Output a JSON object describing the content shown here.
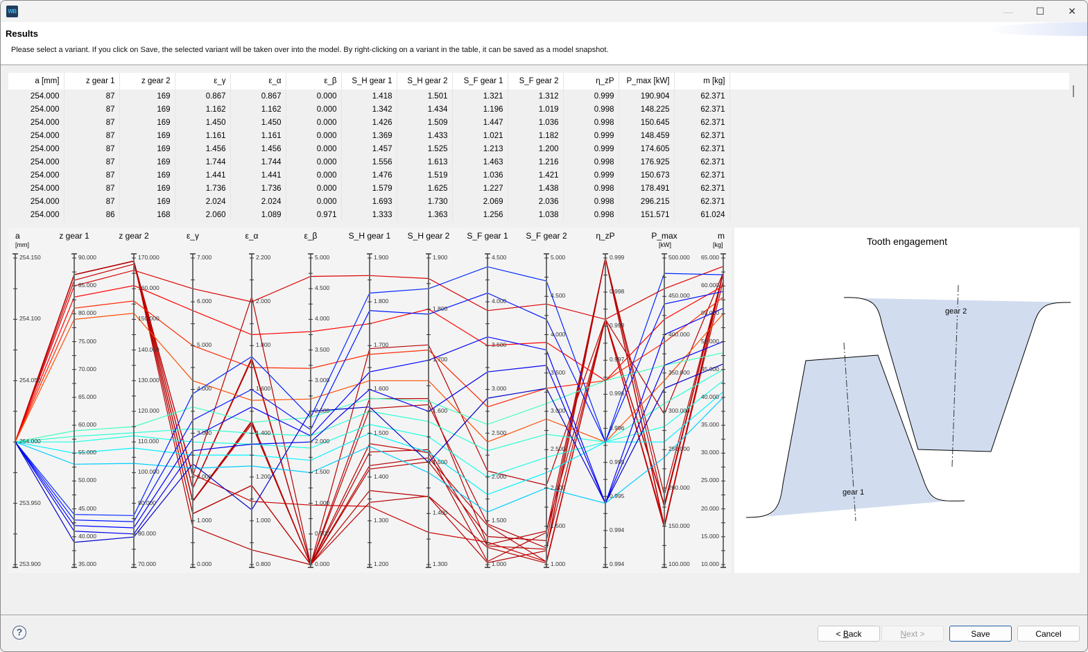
{
  "window": {
    "app_icon_text": "WB",
    "minimize_icon": "—",
    "maximize_icon": "☐",
    "close_icon": "✕"
  },
  "banner": {
    "title": "Results",
    "description": "Please select a variant. If you click on Save, the selected variant will be taken over into the model. By right-clicking on a variant in the table, it can be saved as a model snapshot."
  },
  "table": {
    "columns": [
      "a [mm]",
      "z gear 1",
      "z gear 2",
      "ε_γ",
      "ε_α",
      "ε_β",
      "S_H gear 1",
      "S_H gear 2",
      "S_F gear 1",
      "S_F gear 2",
      "η_zP",
      "P_max [kW]",
      "m [kg]"
    ],
    "rows": [
      [
        "254.000",
        "87",
        "169",
        "0.867",
        "0.867",
        "0.000",
        "1.418",
        "1.501",
        "1.321",
        "1.312",
        "0.999",
        "190.904",
        "62.371"
      ],
      [
        "254.000",
        "87",
        "169",
        "1.162",
        "1.162",
        "0.000",
        "1.342",
        "1.434",
        "1.196",
        "1.019",
        "0.998",
        "148.225",
        "62.371"
      ],
      [
        "254.000",
        "87",
        "169",
        "1.450",
        "1.450",
        "0.000",
        "1.426",
        "1.509",
        "1.447",
        "1.036",
        "0.998",
        "150.645",
        "62.371"
      ],
      [
        "254.000",
        "87",
        "169",
        "1.161",
        "1.161",
        "0.000",
        "1.369",
        "1.433",
        "1.021",
        "1.182",
        "0.999",
        "148.459",
        "62.371"
      ],
      [
        "254.000",
        "87",
        "169",
        "1.456",
        "1.456",
        "0.000",
        "1.457",
        "1.525",
        "1.213",
        "1.200",
        "0.999",
        "174.605",
        "62.371"
      ],
      [
        "254.000",
        "87",
        "169",
        "1.744",
        "1.744",
        "0.000",
        "1.556",
        "1.613",
        "1.463",
        "1.216",
        "0.998",
        "176.925",
        "62.371"
      ],
      [
        "254.000",
        "87",
        "169",
        "1.441",
        "1.441",
        "0.000",
        "1.476",
        "1.519",
        "1.036",
        "1.421",
        "0.999",
        "150.673",
        "62.371"
      ],
      [
        "254.000",
        "87",
        "169",
        "1.736",
        "1.736",
        "0.000",
        "1.579",
        "1.625",
        "1.227",
        "1.438",
        "0.998",
        "178.491",
        "62.371"
      ],
      [
        "254.000",
        "87",
        "169",
        "2.024",
        "2.024",
        "0.000",
        "1.693",
        "1.730",
        "2.069",
        "2.036",
        "0.998",
        "296.215",
        "62.371"
      ],
      [
        "254.000",
        "86",
        "168",
        "2.060",
        "1.089",
        "0.971",
        "1.333",
        "1.363",
        "1.256",
        "1.038",
        "0.998",
        "151.571",
        "61.024"
      ]
    ]
  },
  "chart_data": {
    "type": "parallel-coordinates",
    "title": "",
    "colormap": "jet (blue → cyan → green → yellow → red)",
    "axes": [
      {
        "name": "a",
        "unit": "[mm]",
        "range": [
          253.9,
          254.15
        ],
        "ticks": [
          "254.150",
          "254.100",
          "254.050",
          "254.000",
          "253.950",
          "253.900"
        ]
      },
      {
        "name": "z gear 1",
        "unit": "",
        "range": [
          35,
          90
        ],
        "ticks": [
          "90.000",
          "85.000",
          "80.000",
          "75.000",
          "70.000",
          "65.000",
          "60.000",
          "55.000",
          "50.000",
          "45.000",
          "40.000",
          "35.000"
        ]
      },
      {
        "name": "z gear 2",
        "unit": "",
        "range": [
          70,
          170
        ],
        "ticks": [
          "170.000",
          "160.000",
          "150.000",
          "140.000",
          "130.000",
          "120.000",
          "110.000",
          "100.000",
          "90.000",
          "80.000",
          "70.000"
        ]
      },
      {
        "name": "ε_γ",
        "unit": "",
        "range": [
          0,
          7
        ],
        "ticks": [
          "7.000",
          "6.000",
          "5.000",
          "4.000",
          "3.000",
          "2.000",
          "1.000",
          "0.000"
        ]
      },
      {
        "name": "ε_α",
        "unit": "",
        "range": [
          0.8,
          2.2
        ],
        "ticks": [
          "2.200",
          "2.000",
          "1.800",
          "1.600",
          "1.400",
          "1.200",
          "1.000",
          "0.800"
        ]
      },
      {
        "name": "ε_β",
        "unit": "",
        "range": [
          0,
          5
        ],
        "ticks": [
          "5.000",
          "4.500",
          "4.000",
          "3.500",
          "3.000",
          "2.500",
          "2.000",
          "1.500",
          "1.000",
          "0.500",
          "0.000"
        ]
      },
      {
        "name": "S_H gear 1",
        "unit": "",
        "range": [
          1.2,
          1.9
        ],
        "ticks": [
          "1.900",
          "1.800",
          "1.700",
          "1.600",
          "1.500",
          "1.400",
          "1.300",
          "1.200"
        ]
      },
      {
        "name": "S_H gear 2",
        "unit": "",
        "range": [
          1.3,
          1.9
        ],
        "ticks": [
          "1.900",
          "1.800",
          "1.700",
          "1.600",
          "1.500",
          "1.400",
          "1.300"
        ]
      },
      {
        "name": "S_F gear 1",
        "unit": "",
        "range": [
          1.0,
          4.5
        ],
        "ticks": [
          "4.500",
          "4.000",
          "3.500",
          "3.000",
          "2.500",
          "2.000",
          "1.500",
          "1.000"
        ]
      },
      {
        "name": "S_F gear 2",
        "unit": "",
        "range": [
          1.0,
          5.0
        ],
        "ticks": [
          "5.000",
          "4.500",
          "4.000",
          "3.500",
          "3.000",
          "2.500",
          "2.000",
          "1.500",
          "1.000"
        ]
      },
      {
        "name": "η_zP",
        "unit": "",
        "range": [
          0.994,
          0.999
        ],
        "ticks": [
          "0.999",
          "0.998",
          "0.998",
          "0.997",
          "0.996",
          "0.996",
          "0.995",
          "0.995",
          "0.994",
          "0.994"
        ]
      },
      {
        "name": "P_max",
        "unit": "[kW]",
        "range": [
          100,
          500
        ],
        "ticks": [
          "500.000",
          "450.000",
          "400.000",
          "350.000",
          "300.000",
          "250.000",
          "200.000",
          "150.000",
          "100.000"
        ]
      },
      {
        "name": "m",
        "unit": "[kg]",
        "range": [
          10,
          65
        ],
        "ticks": [
          "65.000",
          "60.000",
          "55.000",
          "50.000",
          "45.000",
          "40.000",
          "35.000",
          "30.000",
          "25.000",
          "20.000",
          "15.000",
          "10.000"
        ]
      }
    ],
    "polylines": [
      {
        "values": [
          254.0,
          87,
          169,
          0.867,
          0.867,
          0.0,
          1.418,
          1.501,
          1.321,
          1.312,
          0.999,
          190.904,
          62.371
        ]
      },
      {
        "values": [
          254.0,
          87,
          169,
          1.162,
          1.162,
          0.0,
          1.342,
          1.434,
          1.196,
          1.019,
          0.998,
          148.225,
          62.371
        ]
      },
      {
        "values": [
          254.0,
          87,
          169,
          1.45,
          1.45,
          0.0,
          1.426,
          1.509,
          1.447,
          1.036,
          0.998,
          150.645,
          62.371
        ]
      },
      {
        "values": [
          254.0,
          87,
          169,
          1.161,
          1.161,
          0.0,
          1.369,
          1.433,
          1.021,
          1.182,
          0.999,
          148.459,
          62.371
        ]
      },
      {
        "values": [
          254.0,
          87,
          169,
          1.456,
          1.456,
          0.0,
          1.457,
          1.525,
          1.213,
          1.2,
          0.999,
          174.605,
          62.371
        ]
      },
      {
        "values": [
          254.0,
          87,
          169,
          1.744,
          1.744,
          0.0,
          1.556,
          1.613,
          1.463,
          1.216,
          0.998,
          176.925,
          62.371
        ]
      },
      {
        "values": [
          254.0,
          87,
          169,
          1.441,
          1.441,
          0.0,
          1.476,
          1.519,
          1.036,
          1.421,
          0.999,
          150.673,
          62.371
        ]
      },
      {
        "values": [
          254.0,
          87,
          169,
          1.736,
          1.736,
          0.0,
          1.579,
          1.625,
          1.227,
          1.438,
          0.998,
          178.491,
          62.371
        ]
      },
      {
        "values": [
          254.0,
          87,
          169,
          2.024,
          2.024,
          0.0,
          1.693,
          1.73,
          2.069,
          2.036,
          0.998,
          296.215,
          62.371
        ]
      },
      {
        "values": [
          254.0,
          86,
          168,
          2.06,
          1.089,
          0.971,
          1.333,
          1.363,
          1.256,
          1.038,
          0.998,
          151.571,
          61.024
        ]
      },
      {
        "values": [
          254.0,
          85,
          166,
          6.3,
          2.0,
          4.7,
          1.86,
          1.86,
          3.9,
          4.4,
          0.998,
          460,
          63.5
        ]
      },
      {
        "values": [
          254.0,
          83,
          161,
          5.8,
          1.85,
          3.8,
          1.75,
          1.8,
          3.5,
          3.9,
          0.997,
          420,
          60.0
        ]
      },
      {
        "values": [
          254.0,
          81,
          156,
          5.0,
          1.7,
          3.2,
          1.68,
          1.72,
          2.8,
          3.3,
          0.997,
          390,
          58.0
        ]
      },
      {
        "values": [
          254.0,
          79,
          152,
          4.2,
          1.55,
          2.7,
          1.62,
          1.66,
          2.4,
          2.9,
          0.996,
          340,
          55.0
        ]
      },
      {
        "values": [
          254.0,
          59,
          115,
          3.6,
          1.45,
          2.4,
          1.58,
          1.62,
          2.6,
          3.1,
          0.997,
          360,
          48.0
        ]
      },
      {
        "values": [
          254.0,
          58,
          113,
          3.1,
          1.4,
          2.1,
          1.55,
          1.58,
          2.3,
          2.7,
          0.996,
          310,
          45.0
        ]
      },
      {
        "values": [
          254.0,
          57,
          112,
          2.8,
          1.35,
          1.9,
          1.52,
          1.55,
          2.0,
          2.4,
          0.996,
          280,
          43.0
        ]
      },
      {
        "values": [
          254.0,
          55,
          108,
          2.5,
          1.3,
          1.7,
          1.5,
          1.52,
          1.8,
          2.2,
          0.996,
          260,
          41.0
        ]
      },
      {
        "values": [
          254.0,
          53,
          103,
          2.2,
          1.25,
          1.5,
          1.47,
          1.48,
          1.6,
          2.0,
          0.995,
          240,
          40.0
        ]
      },
      {
        "values": [
          254.0,
          44,
          86,
          3.9,
          1.75,
          2.4,
          1.82,
          1.84,
          4.4,
          4.7,
          0.996,
          480,
          62.0
        ]
      },
      {
        "values": [
          254.0,
          43,
          84,
          3.3,
          1.6,
          2.2,
          1.78,
          1.79,
          4.1,
          4.2,
          0.996,
          440,
          59.0
        ]
      },
      {
        "values": [
          254.0,
          42,
          82,
          2.9,
          1.52,
          2.1,
          1.64,
          1.7,
          3.6,
          3.8,
          0.995,
          400,
          56.0
        ]
      },
      {
        "values": [
          254.0,
          41,
          80,
          2.6,
          1.35,
          2.0,
          1.6,
          1.6,
          3.2,
          3.6,
          0.995,
          360,
          50.0
        ]
      },
      {
        "values": [
          254.0,
          39,
          79,
          2.3,
          1.05,
          2.5,
          1.56,
          1.5,
          2.9,
          3.3,
          0.995,
          330,
          46.0
        ]
      }
    ]
  },
  "tooth_engagement": {
    "title": "Tooth engagement",
    "gear1_label": "gear 1",
    "gear2_label": "gear 2",
    "fill_color": "#d1dcef"
  },
  "footer": {
    "help_icon": "?",
    "back_label": "< Back",
    "back_mnemonic": "B",
    "next_label": "Next >",
    "next_mnemonic": "N",
    "save_label": "Save",
    "cancel_label": "Cancel"
  }
}
